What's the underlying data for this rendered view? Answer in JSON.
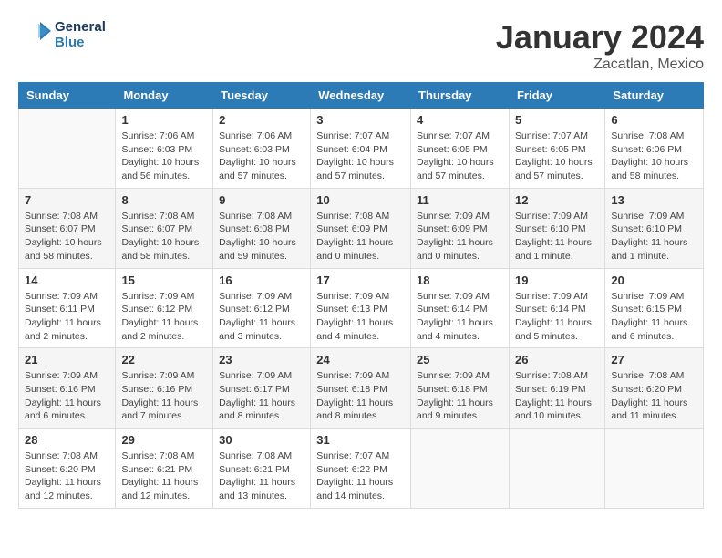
{
  "header": {
    "logo_line1": "General",
    "logo_line2": "Blue",
    "month": "January 2024",
    "location": "Zacatlan, Mexico"
  },
  "weekdays": [
    "Sunday",
    "Monday",
    "Tuesday",
    "Wednesday",
    "Thursday",
    "Friday",
    "Saturday"
  ],
  "weeks": [
    [
      {
        "day": "",
        "info": ""
      },
      {
        "day": "1",
        "info": "Sunrise: 7:06 AM\nSunset: 6:03 PM\nDaylight: 10 hours\nand 56 minutes."
      },
      {
        "day": "2",
        "info": "Sunrise: 7:06 AM\nSunset: 6:03 PM\nDaylight: 10 hours\nand 57 minutes."
      },
      {
        "day": "3",
        "info": "Sunrise: 7:07 AM\nSunset: 6:04 PM\nDaylight: 10 hours\nand 57 minutes."
      },
      {
        "day": "4",
        "info": "Sunrise: 7:07 AM\nSunset: 6:05 PM\nDaylight: 10 hours\nand 57 minutes."
      },
      {
        "day": "5",
        "info": "Sunrise: 7:07 AM\nSunset: 6:05 PM\nDaylight: 10 hours\nand 57 minutes."
      },
      {
        "day": "6",
        "info": "Sunrise: 7:08 AM\nSunset: 6:06 PM\nDaylight: 10 hours\nand 58 minutes."
      }
    ],
    [
      {
        "day": "7",
        "info": "Sunrise: 7:08 AM\nSunset: 6:07 PM\nDaylight: 10 hours\nand 58 minutes."
      },
      {
        "day": "8",
        "info": "Sunrise: 7:08 AM\nSunset: 6:07 PM\nDaylight: 10 hours\nand 58 minutes."
      },
      {
        "day": "9",
        "info": "Sunrise: 7:08 AM\nSunset: 6:08 PM\nDaylight: 10 hours\nand 59 minutes."
      },
      {
        "day": "10",
        "info": "Sunrise: 7:08 AM\nSunset: 6:09 PM\nDaylight: 11 hours\nand 0 minutes."
      },
      {
        "day": "11",
        "info": "Sunrise: 7:09 AM\nSunset: 6:09 PM\nDaylight: 11 hours\nand 0 minutes."
      },
      {
        "day": "12",
        "info": "Sunrise: 7:09 AM\nSunset: 6:10 PM\nDaylight: 11 hours\nand 1 minute."
      },
      {
        "day": "13",
        "info": "Sunrise: 7:09 AM\nSunset: 6:10 PM\nDaylight: 11 hours\nand 1 minute."
      }
    ],
    [
      {
        "day": "14",
        "info": "Sunrise: 7:09 AM\nSunset: 6:11 PM\nDaylight: 11 hours\nand 2 minutes."
      },
      {
        "day": "15",
        "info": "Sunrise: 7:09 AM\nSunset: 6:12 PM\nDaylight: 11 hours\nand 2 minutes."
      },
      {
        "day": "16",
        "info": "Sunrise: 7:09 AM\nSunset: 6:12 PM\nDaylight: 11 hours\nand 3 minutes."
      },
      {
        "day": "17",
        "info": "Sunrise: 7:09 AM\nSunset: 6:13 PM\nDaylight: 11 hours\nand 4 minutes."
      },
      {
        "day": "18",
        "info": "Sunrise: 7:09 AM\nSunset: 6:14 PM\nDaylight: 11 hours\nand 4 minutes."
      },
      {
        "day": "19",
        "info": "Sunrise: 7:09 AM\nSunset: 6:14 PM\nDaylight: 11 hours\nand 5 minutes."
      },
      {
        "day": "20",
        "info": "Sunrise: 7:09 AM\nSunset: 6:15 PM\nDaylight: 11 hours\nand 6 minutes."
      }
    ],
    [
      {
        "day": "21",
        "info": "Sunrise: 7:09 AM\nSunset: 6:16 PM\nDaylight: 11 hours\nand 6 minutes."
      },
      {
        "day": "22",
        "info": "Sunrise: 7:09 AM\nSunset: 6:16 PM\nDaylight: 11 hours\nand 7 minutes."
      },
      {
        "day": "23",
        "info": "Sunrise: 7:09 AM\nSunset: 6:17 PM\nDaylight: 11 hours\nand 8 minutes."
      },
      {
        "day": "24",
        "info": "Sunrise: 7:09 AM\nSunset: 6:18 PM\nDaylight: 11 hours\nand 8 minutes."
      },
      {
        "day": "25",
        "info": "Sunrise: 7:09 AM\nSunset: 6:18 PM\nDaylight: 11 hours\nand 9 minutes."
      },
      {
        "day": "26",
        "info": "Sunrise: 7:08 AM\nSunset: 6:19 PM\nDaylight: 11 hours\nand 10 minutes."
      },
      {
        "day": "27",
        "info": "Sunrise: 7:08 AM\nSunset: 6:20 PM\nDaylight: 11 hours\nand 11 minutes."
      }
    ],
    [
      {
        "day": "28",
        "info": "Sunrise: 7:08 AM\nSunset: 6:20 PM\nDaylight: 11 hours\nand 12 minutes."
      },
      {
        "day": "29",
        "info": "Sunrise: 7:08 AM\nSunset: 6:21 PM\nDaylight: 11 hours\nand 12 minutes."
      },
      {
        "day": "30",
        "info": "Sunrise: 7:08 AM\nSunset: 6:21 PM\nDaylight: 11 hours\nand 13 minutes."
      },
      {
        "day": "31",
        "info": "Sunrise: 7:07 AM\nSunset: 6:22 PM\nDaylight: 11 hours\nand 14 minutes."
      },
      {
        "day": "",
        "info": ""
      },
      {
        "day": "",
        "info": ""
      },
      {
        "day": "",
        "info": ""
      }
    ]
  ]
}
